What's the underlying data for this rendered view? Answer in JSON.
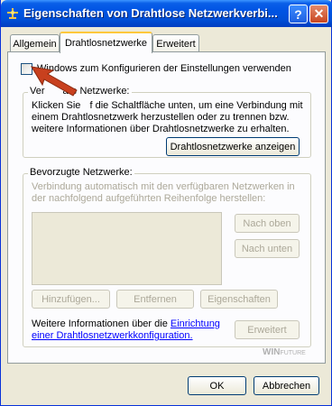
{
  "window": {
    "title": "Eigenschaften von Drahtlose Netzwerkverbi...",
    "help_label": "?",
    "close_label": "✕"
  },
  "tabs": [
    {
      "label": "Allgemein",
      "active": false
    },
    {
      "label": "Drahtlosnetzwerke",
      "active": true
    },
    {
      "label": "Erweitert",
      "active": false
    }
  ],
  "checkbox": {
    "label": "Windows zum Konfigurieren der Einstellungen verwenden",
    "checked": false
  },
  "available_group": {
    "title_pre": "Ver",
    "title_post": "are Netzwerke:",
    "text_line1_pre": "Klicken Sie ",
    "text_line1_post": "f die Schaltfläche unten, um eine Verbindung mit",
    "text_line2": "einem Drahtlosnetzwerk herzustellen oder zu trennen bzw.",
    "text_line3": "weitere Informationen über Drahtlosnetzwerke zu erhalten.",
    "button": "Drahtlosnetzwerke anzeigen"
  },
  "preferred_group": {
    "title": "Bevorzugte Netzwerke:",
    "text_line1": "Verbindung automatisch mit den verfügbaren Netzwerken in",
    "text_line2": "der nachfolgend aufgeführten Reihenfolge herstellen:",
    "up_button": "Nach oben",
    "down_button": "Nach unten",
    "add_button": "Hinzufügen...",
    "remove_button": "Entfernen",
    "properties_button": "Eigenschaften",
    "info_pre": "Weitere Informationen über die ",
    "info_link1": "Einrichtung",
    "info_link2": "einer Drahtlosnetzwerkkonfiguration.",
    "advanced_button": "Erweitert"
  },
  "footer": {
    "ok": "OK",
    "cancel": "Abbrechen"
  },
  "watermark": {
    "text1": "WIN",
    "text2": "FUTURE"
  },
  "colors": {
    "annotation_arrow": "#c8401e",
    "titlebar": "#0054e3"
  }
}
